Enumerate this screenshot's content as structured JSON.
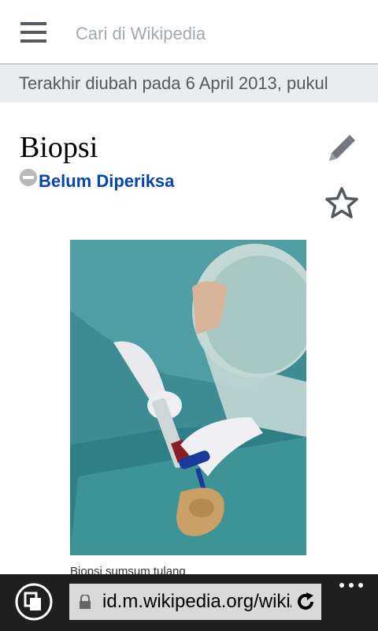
{
  "search": {
    "placeholder": "Cari di Wikipedia"
  },
  "last_modified": "Terakhir diubah pada 6 April 2013, pukul",
  "page": {
    "title": "Biopsi",
    "review_status": "Belum Diperiksa"
  },
  "figure": {
    "caption": "Biopsi sumsum tulang"
  },
  "browser": {
    "url": "id.m.wikipedia.org/wiki/Biopsi"
  },
  "icons": {
    "menu": "hamburger-menu-icon",
    "edit": "pencil-icon",
    "watch": "star-icon",
    "review": "circle-minus-icon",
    "tabs": "tabs-icon",
    "lock": "lock-icon",
    "reload": "reload-icon",
    "more": "more-dots-icon"
  },
  "colors": {
    "link": "#0645ad",
    "header_bar": "#eaecf0",
    "browser_bar": "#1f1f1f"
  }
}
